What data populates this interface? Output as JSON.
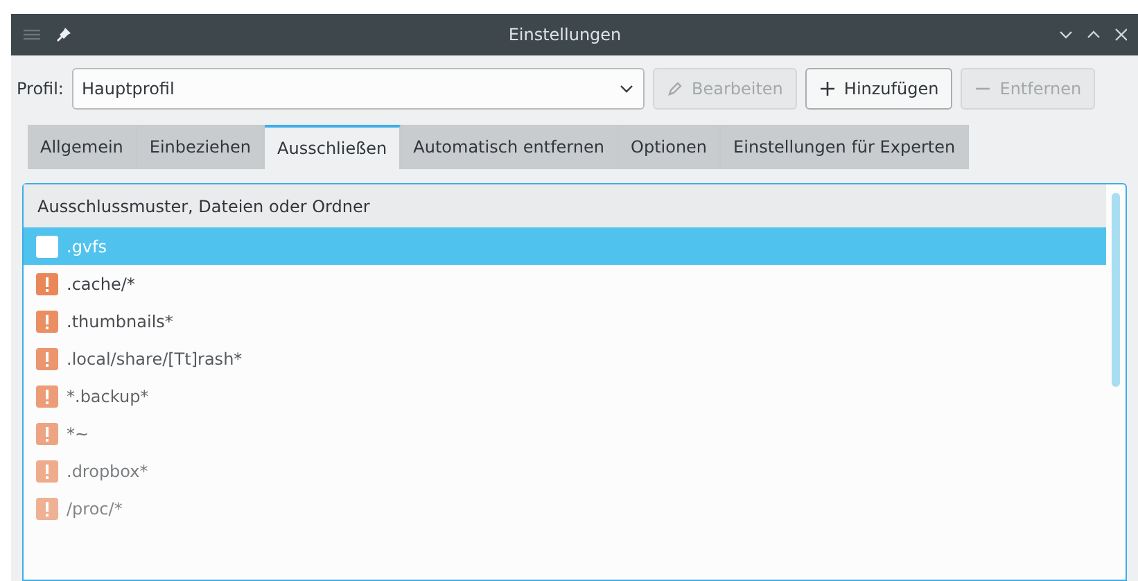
{
  "window": {
    "title": "Einstellungen"
  },
  "profile": {
    "label": "Profil:",
    "value": "Hauptprofil"
  },
  "buttons": [
    {
      "label": "Bearbeiten",
      "kind": "edit",
      "disabled": true
    },
    {
      "label": "Hinzufügen",
      "kind": "add",
      "disabled": false
    },
    {
      "label": "Entfernen",
      "kind": "remove",
      "disabled": true
    }
  ],
  "tabs": [
    {
      "label": "Allgemein",
      "selected": false
    },
    {
      "label": "Einbeziehen",
      "selected": false
    },
    {
      "label": "Ausschließen",
      "selected": true
    },
    {
      "label": "Automatisch entfernen",
      "selected": false
    },
    {
      "label": "Optionen",
      "selected": false
    },
    {
      "label": "Einstellungen für Experten",
      "selected": false
    }
  ],
  "list": {
    "header": "Ausschlussmuster, Dateien oder Ordner",
    "rows": [
      {
        "text": ".gvfs",
        "selected": true
      },
      {
        "text": ".cache/*",
        "selected": false
      },
      {
        "text": ".thumbnails*",
        "selected": false
      },
      {
        "text": ".local/share/[Tt]rash*",
        "selected": false
      },
      {
        "text": "*.backup*",
        "selected": false
      },
      {
        "text": "*~",
        "selected": false
      },
      {
        "text": ".dropbox*",
        "selected": false
      },
      {
        "text": "/proc/*",
        "selected": false
      }
    ]
  }
}
